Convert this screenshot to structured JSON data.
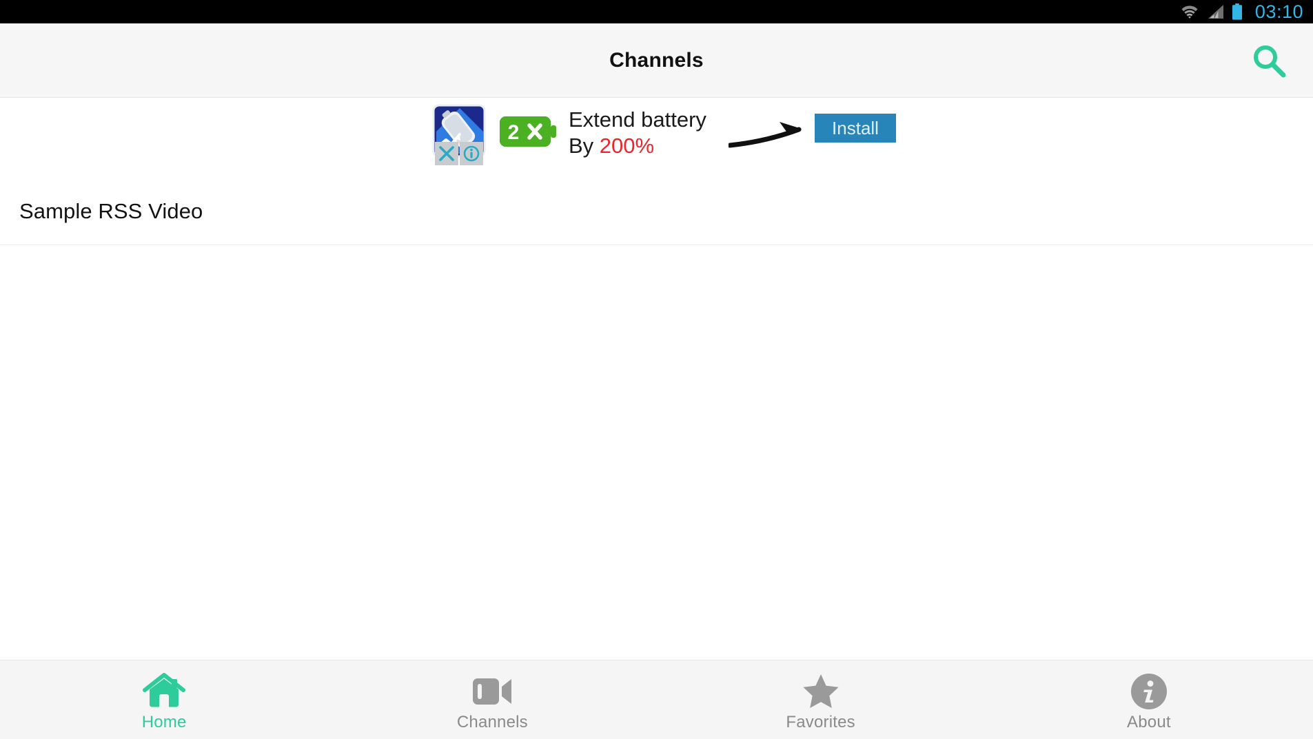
{
  "status_bar": {
    "clock": "03:10",
    "icons": [
      "wifi-icon",
      "cellular-signal-icon",
      "battery-icon"
    ],
    "background_color": "#000000",
    "clock_color": "#33b5e5"
  },
  "action_bar": {
    "title": "Channels",
    "search_icon": "search-icon",
    "accent_color": "#2ecc9b",
    "background_color": "#f6f6f6"
  },
  "ad_banner": {
    "headline_line1": "Extend battery",
    "headline_line2_prefix": "By ",
    "headline_line2_value": "200%",
    "badge_text": "2",
    "badge_multiplier": "×",
    "install_label": "Install",
    "close_icon": "close-icon",
    "info_icon": "ad-info-icon",
    "app_icon": "battery-app-icon",
    "arrow_icon": "arrow-right-icon",
    "install_color": "#2885ba",
    "highlight_color": "#e8262d"
  },
  "content": {
    "items": [
      {
        "title": "Sample RSS Video"
      }
    ]
  },
  "bottom_nav": {
    "active_color": "#2ecc9b",
    "inactive_color": "#9a9a9a",
    "tabs": [
      {
        "label": "Home",
        "icon": "home-icon",
        "active": true
      },
      {
        "label": "Channels",
        "icon": "video-camera-icon",
        "active": false
      },
      {
        "label": "Favorites",
        "icon": "star-icon",
        "active": false
      },
      {
        "label": "About",
        "icon": "info-circle-icon",
        "active": false
      }
    ]
  }
}
